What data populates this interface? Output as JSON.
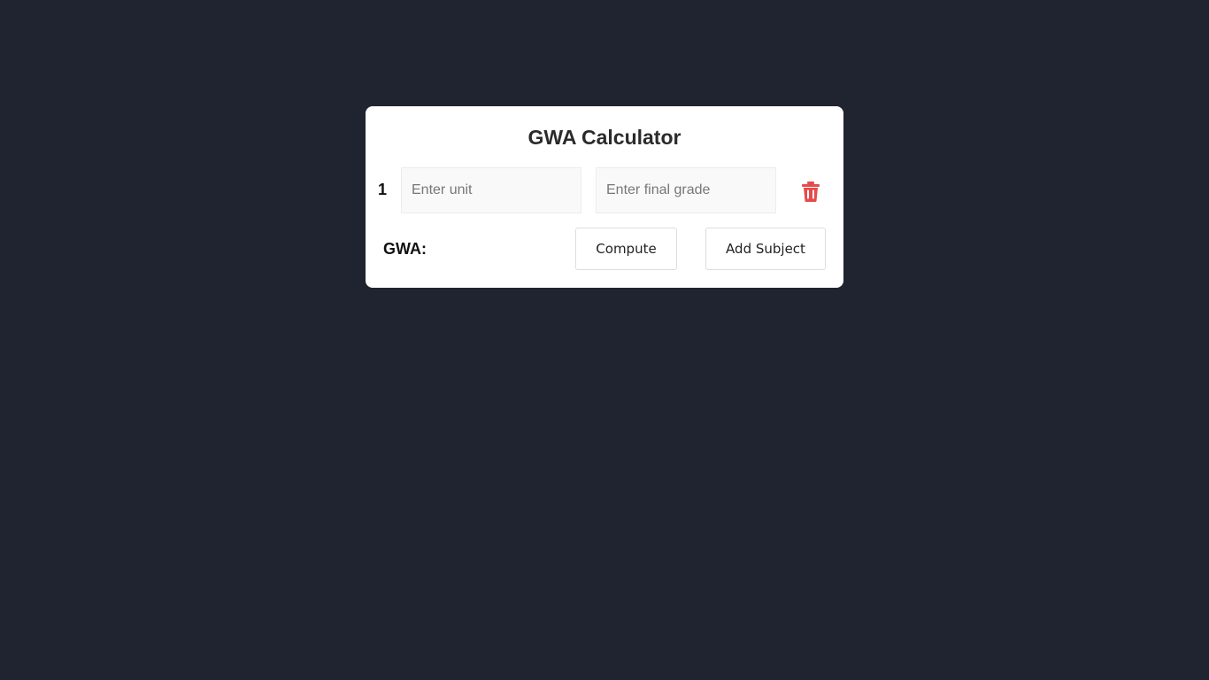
{
  "app": {
    "title": "GWA Calculator"
  },
  "subjects": [
    {
      "index": "1",
      "unit_placeholder": "Enter unit",
      "unit_value": "",
      "grade_placeholder": "Enter final grade",
      "grade_value": "",
      "delete_icon": "trash-icon"
    }
  ],
  "result": {
    "label": "GWA:",
    "value": ""
  },
  "actions": {
    "compute_label": "Compute",
    "add_subject_label": "Add Subject"
  },
  "colors": {
    "background": "#1f2430",
    "card": "#ffffff",
    "delete_accent": "#e54b4b"
  }
}
